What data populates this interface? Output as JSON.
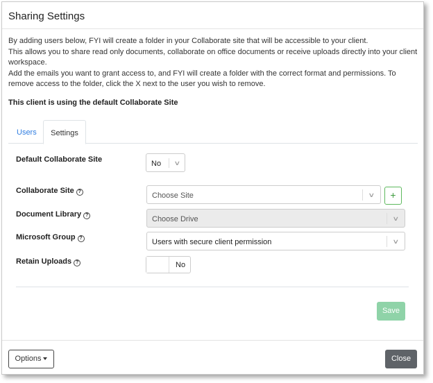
{
  "dialog": {
    "title": "Sharing Settings"
  },
  "intro": {
    "lines": [
      "By adding users below, FYI will create a folder in your Collaborate site that will be accessible to your client.",
      "This allows you to share read only documents, collaborate on office documents or receive uploads directly into your client workspace.",
      "Add the emails you want to grant access to, and FYI will create a folder with the correct format and permissions. To remove access to the folder, click the X next to the user you wish to remove."
    ],
    "notice": "This client is using the default Collaborate Site"
  },
  "tabs": [
    {
      "label": "Users"
    },
    {
      "label": "Settings"
    }
  ],
  "form": {
    "default_site": {
      "label": "Default Collaborate Site",
      "value": "No"
    },
    "collab_site": {
      "label": "Collaborate Site",
      "placeholder": "Choose Site",
      "add_label": "+"
    },
    "doc_library": {
      "label": "Document Library",
      "placeholder": "Choose Drive"
    },
    "ms_group": {
      "label": "Microsoft Group",
      "value": "Users with secure client permission"
    },
    "retain": {
      "label": "Retain Uploads",
      "value": "No"
    },
    "help_glyph": "?",
    "chevron_glyph": "∨",
    "save_label": "Save"
  },
  "footer": {
    "options_label": "Options",
    "close_label": "Close"
  },
  "colors": {
    "link": "#2f7de1",
    "success": "#5cb85c",
    "save_disabled": "#8fd3a8",
    "close_bg": "#5f6368"
  },
  "icons": {
    "help": "help-circle-icon",
    "chevron": "chevron-down-icon",
    "plus": "plus-icon",
    "caret": "caret-down-icon"
  }
}
